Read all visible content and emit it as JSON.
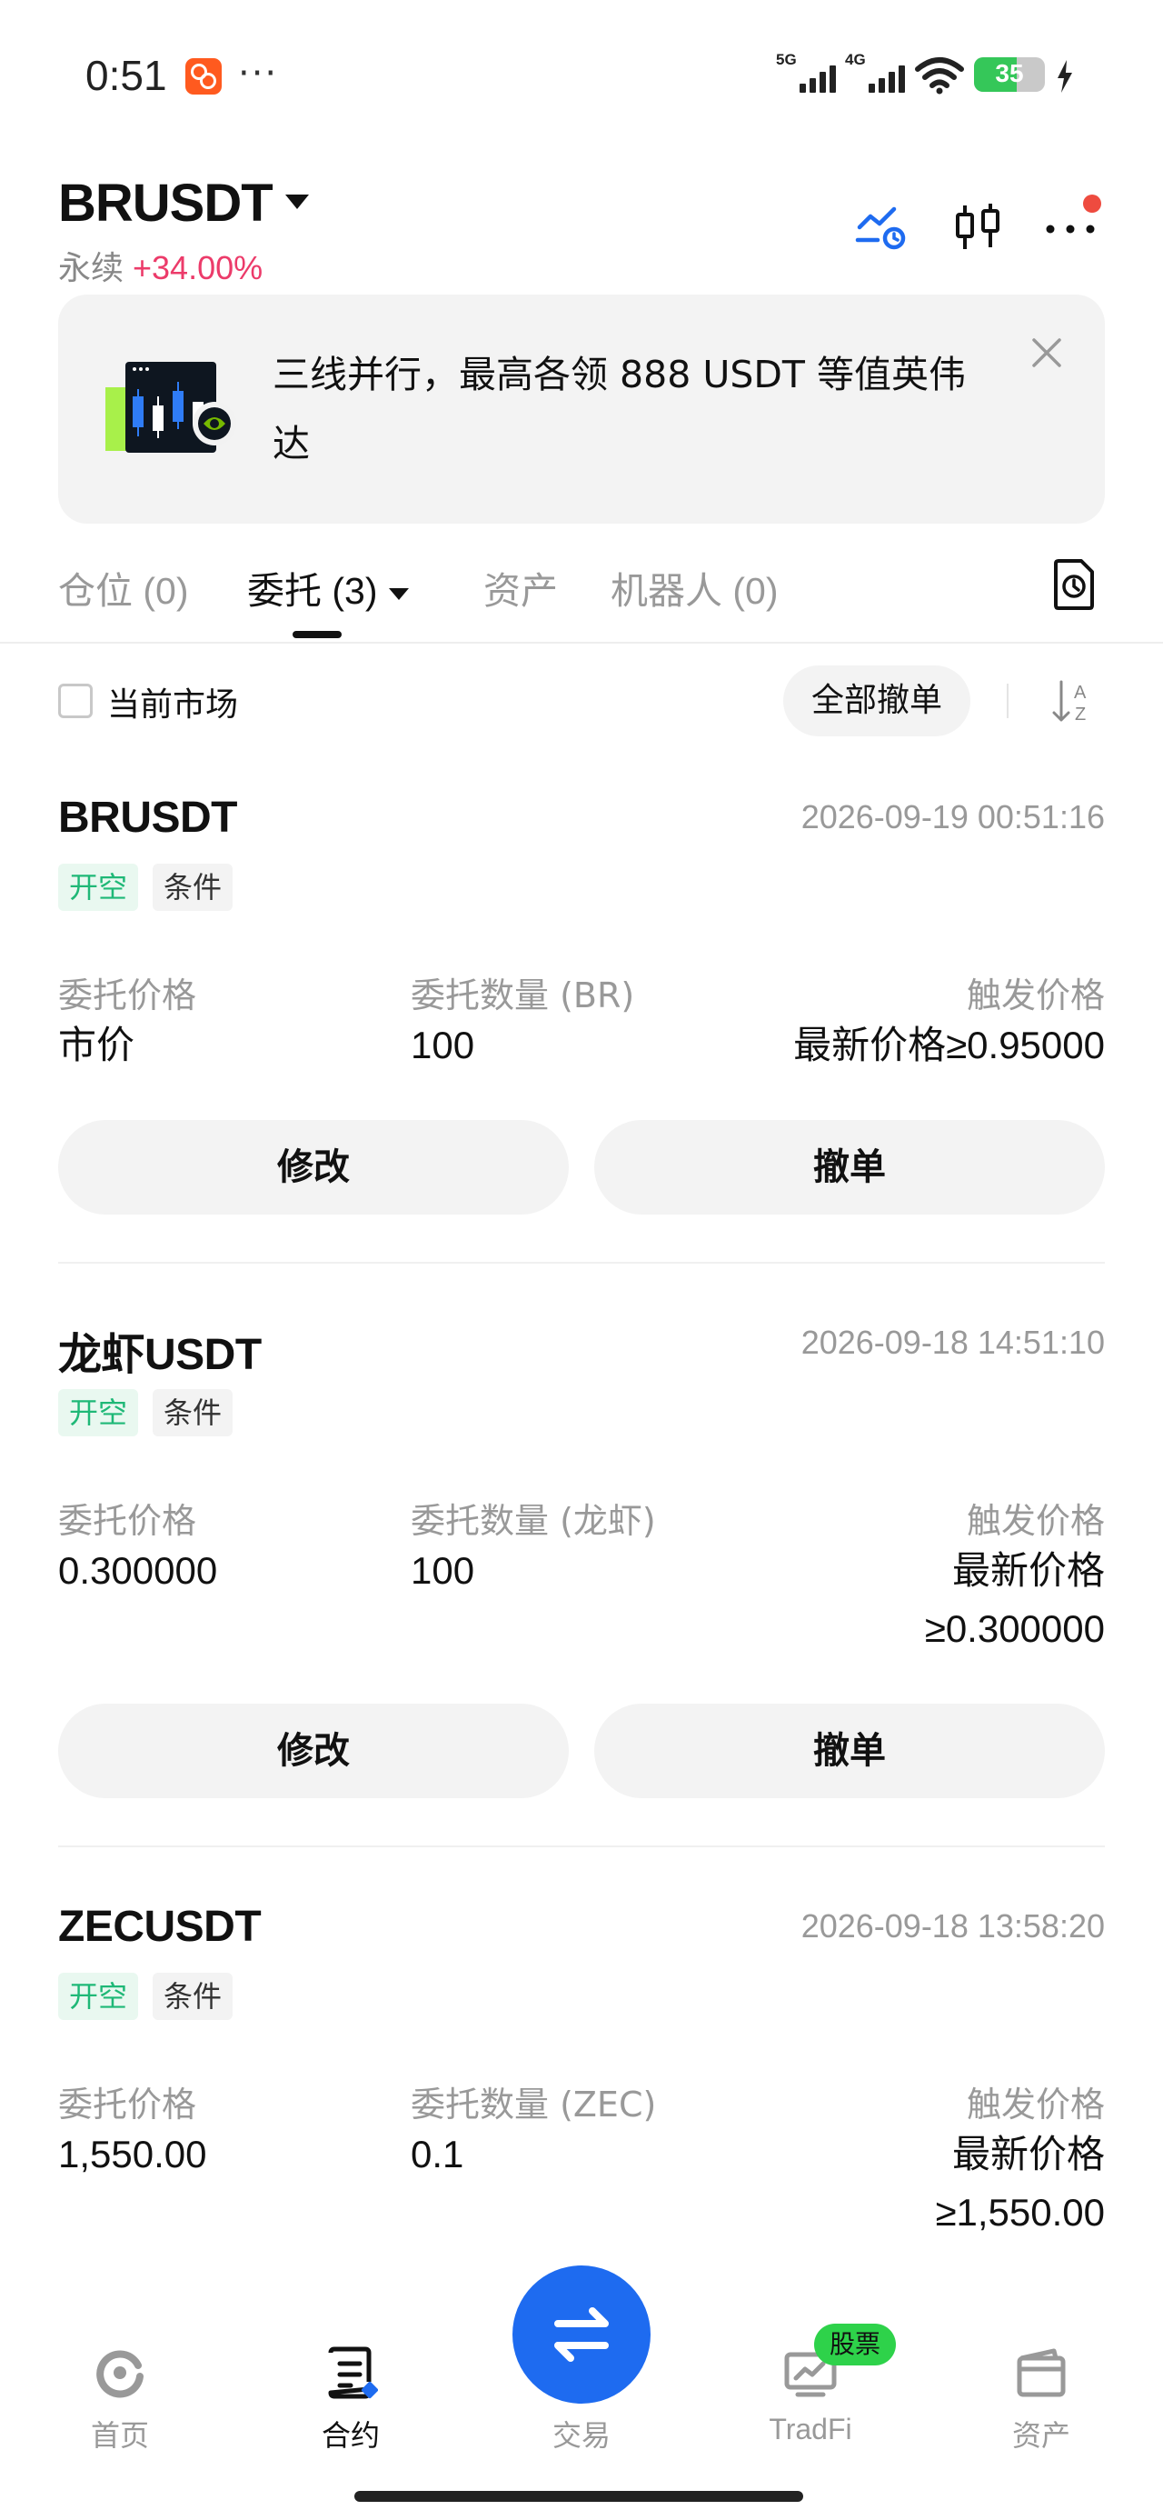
{
  "status_bar": {
    "time": "0:51",
    "dots": "···",
    "net1": "5G",
    "net2": "4G",
    "battery": "35"
  },
  "header": {
    "pair": "BRUSDT",
    "type": "永续",
    "change": "+34.00%"
  },
  "banner": {
    "text": "三线并行，最高各领 888 USDT 等值英伟达"
  },
  "tabs": [
    {
      "label": "仓位 (0)"
    },
    {
      "label": "委托 (3)"
    },
    {
      "label": "资产"
    },
    {
      "label": "机器人 (0)"
    }
  ],
  "filter": {
    "current_market": "当前市场",
    "cancel_all": "全部撤单"
  },
  "orders": [
    {
      "symbol": "BRUSDT",
      "time": "2026-09-19 00:51:16",
      "tag_side": "开空",
      "tag_type": "条件",
      "price_label": "委托价格",
      "price": "市价",
      "qty_label": "委托数量 (BR)",
      "qty": "100",
      "trigger_label": "触发价格",
      "trigger_line1": "最新价格≥0.95000",
      "trigger_line2": "",
      "modify": "修改",
      "cancel": "撤单"
    },
    {
      "symbol": "龙虾USDT",
      "time": "2026-09-18 14:51:10",
      "tag_side": "开空",
      "tag_type": "条件",
      "price_label": "委托价格",
      "price": "0.300000",
      "qty_label": "委托数量 (龙虾)",
      "qty": "100",
      "trigger_label": "触发价格",
      "trigger_line1": "最新价格",
      "trigger_line2": "≥0.300000",
      "modify": "修改",
      "cancel": "撤单"
    },
    {
      "symbol": "ZECUSDT",
      "time": "2026-09-18 13:58:20",
      "tag_side": "开空",
      "tag_type": "条件",
      "price_label": "委托价格",
      "price": "1,550.00",
      "qty_label": "委托数量 (ZEC)",
      "qty": "0.1",
      "trigger_label": "触发价格",
      "trigger_line1": "最新价格",
      "trigger_line2": "≥1,550.00"
    }
  ],
  "bottom_nav": {
    "home": "首页",
    "contract": "合约",
    "trade": "交易",
    "tradfi": "TradFi",
    "tradfi_badge": "股票",
    "assets": "资产"
  },
  "colors": {
    "accent_blue": "#1e6bf0",
    "change_pink": "#ec3b6a",
    "tag_green": "#1fb877",
    "badge_green": "#2ed24a"
  }
}
